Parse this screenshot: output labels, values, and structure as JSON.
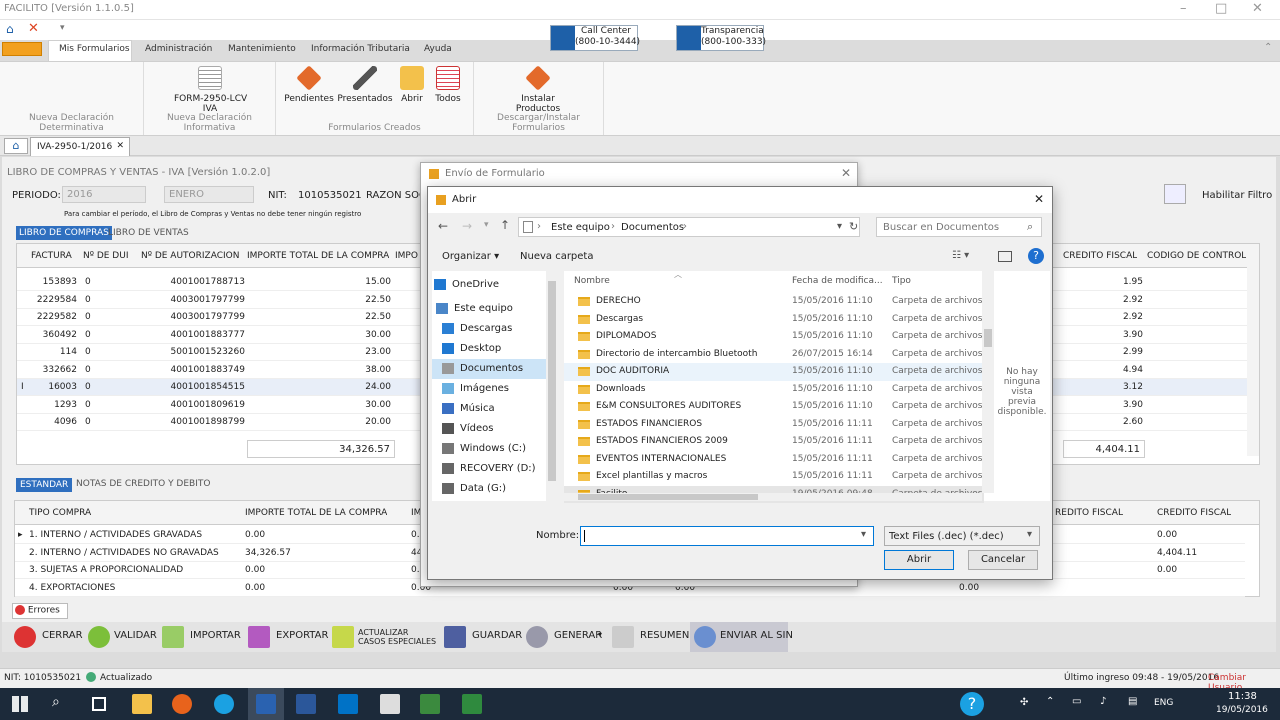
{
  "app": {
    "title": "FACILITO [Versión 1.1.0.5]"
  },
  "menu": [
    "Mis Formularios",
    "Administración",
    "Mantenimiento",
    "Información Tributaria",
    "Ayuda"
  ],
  "header_buttons": [
    {
      "label": "Call Center\n(800-10-3444)"
    },
    {
      "label": "Transparencia\n(800-100-333)"
    }
  ],
  "ribbon": {
    "groups": [
      {
        "label": "Nueva Declaración Determinativa"
      },
      {
        "label": "Nueva Declaración Informativa",
        "buttons": [
          "FORM-2950-LCV\nIVA"
        ]
      },
      {
        "label": "Formularios Creados",
        "buttons": [
          "Pendientes",
          "Presentados",
          "Abrir",
          "Todos"
        ]
      },
      {
        "label": "Descargar/Instalar Formularios",
        "buttons": [
          "Instalar\nProductos"
        ]
      }
    ]
  },
  "doc_tab": "IVA-2950-1/2016",
  "form": {
    "title": "LIBRO DE COMPRAS Y VENTAS - IVA [Versión 1.0.2.0]",
    "periodo_label": "PERIODO:",
    "year": "2016",
    "month": "ENERO",
    "nit_label": "NIT:",
    "nit": "1010535021",
    "razon_label": "RAZON SOCI",
    "note": "Para cambiar el período, el Libro de Compras y Ventas no debe tener ningún registro",
    "tab_compras": "LIBRO DE COMPRAS",
    "tab_ventas": "LIBRO DE VENTAS",
    "habilitar": "Habilitar Filtro"
  },
  "grid1": {
    "headers": [
      "FACTURA",
      "Nº DE DUI",
      "Nº DE AUTORIZACION",
      "IMPORTE TOTAL DE LA COMPRA",
      "IMPO",
      "CREDITO FISCAL",
      "CODIGO DE CONTROL"
    ],
    "rows": [
      [
        "153893",
        "0",
        "4001001788713",
        "15.00",
        "1.95"
      ],
      [
        "2229584",
        "0",
        "4003001797799",
        "22.50",
        "2.92"
      ],
      [
        "2229582",
        "0",
        "4003001797799",
        "22.50",
        "2.92"
      ],
      [
        "360492",
        "0",
        "4001001883777",
        "30.00",
        "3.90"
      ],
      [
        "114",
        "0",
        "5001001523260",
        "23.00",
        "2.99"
      ],
      [
        "332662",
        "0",
        "4001001883749",
        "38.00",
        "4.94"
      ],
      [
        "16003",
        "0",
        "4001001854515",
        "24.00",
        "3.12"
      ],
      [
        "1293",
        "0",
        "4001001809619",
        "30.00",
        "3.90"
      ],
      [
        "4096",
        "0",
        "4001001898799",
        "20.00",
        "2.60"
      ]
    ],
    "total_importe": "34,326.57",
    "total_credito": "4,404.11",
    "row_marker": "I"
  },
  "tabs2": {
    "estandar": "ESTANDAR",
    "notas": "NOTAS DE CREDITO Y DEBITO"
  },
  "grid2": {
    "headers": [
      "TIPO COMPRA",
      "IMPORTE TOTAL DE LA COMPRA",
      "IM",
      "REDITO FISCAL",
      "CREDITO FISCAL"
    ],
    "rows": [
      [
        "1. INTERNO / ACTIVIDADES GRAVADAS",
        "0.00",
        "0.00",
        "0.00"
      ],
      [
        "2. INTERNO / ACTIVIDADES NO GRAVADAS",
        "34,326.57",
        "448",
        "4,404.11"
      ],
      [
        "3. SUJETAS A PROPORCIONALIDAD",
        "0.00",
        "0.00",
        "0.00"
      ],
      [
        "4. EXPORTACIONES",
        "0.00",
        "0.00",
        "0.00",
        "0.00",
        "0.00"
      ]
    ]
  },
  "errores": "Errores",
  "toolbar": [
    "CERRAR",
    "VALIDAR",
    "IMPORTAR",
    "EXPORTAR",
    "ACTUALIZAR\nCASOS ESPECIALES",
    "GUARDAR",
    "GENERAR",
    "RESUMEN",
    "ENVIAR AL SIN"
  ],
  "status": {
    "nit": "NIT: 1010535021",
    "state": "Actualizado",
    "last": "Último ingreso 09:48 - 19/05/2016",
    "change": "Cambiar Usuario"
  },
  "envio": {
    "title": "Envío de Formulario"
  },
  "dialog": {
    "title": "Abrir",
    "path": [
      "Este equipo",
      "Documentos"
    ],
    "search_placeholder": "Buscar en Documentos",
    "organizar": "Organizar",
    "nueva": "Nueva carpeta",
    "cols": [
      "Nombre",
      "Fecha de modifica...",
      "Tipo"
    ],
    "left": [
      "OneDrive",
      "Este equipo",
      "Descargas",
      "Desktop",
      "Documentos",
      "Imágenes",
      "Música",
      "Vídeos",
      "Windows (C:)",
      "RECOVERY (D:)",
      "Data (G:)"
    ],
    "files": [
      [
        "DERECHO",
        "15/05/2016 11:10",
        "Carpeta de archivos"
      ],
      [
        "Descargas",
        "15/05/2016 11:10",
        "Carpeta de archivos"
      ],
      [
        "DIPLOMADOS",
        "15/05/2016 11:10",
        "Carpeta de archivos"
      ],
      [
        "Directorio de intercambio Bluetooth",
        "26/07/2015 16:14",
        "Carpeta de archivos"
      ],
      [
        "DOC AUDITORIA",
        "15/05/2016 11:10",
        "Carpeta de archivos"
      ],
      [
        "Downloads",
        "15/05/2016 11:10",
        "Carpeta de archivos"
      ],
      [
        "E&M CONSULTORES AUDITORES",
        "15/05/2016 11:10",
        "Carpeta de archivos"
      ],
      [
        "ESTADOS FINANCIEROS",
        "15/05/2016 11:11",
        "Carpeta de archivos"
      ],
      [
        "ESTADOS FINANCIEROS 2009",
        "15/05/2016 11:11",
        "Carpeta de archivos"
      ],
      [
        "EVENTOS INTERNACIONALES",
        "15/05/2016 11:11",
        "Carpeta de archivos"
      ],
      [
        "Excel plantillas y macros",
        "15/05/2016 11:11",
        "Carpeta de archivos"
      ],
      [
        "Facilito",
        "19/05/2016 09:48",
        "Carpeta de archivos"
      ]
    ],
    "preview": "No hay ninguna vista previa disponible.",
    "name_label": "Nombre:",
    "name_value": "",
    "filter": "Text Files (.dec) (*.dec)",
    "open": "Abrir",
    "cancel": "Cancelar"
  },
  "taskbar": {
    "time": "11:38",
    "date": "19/05/2016",
    "lang": "ENG"
  }
}
